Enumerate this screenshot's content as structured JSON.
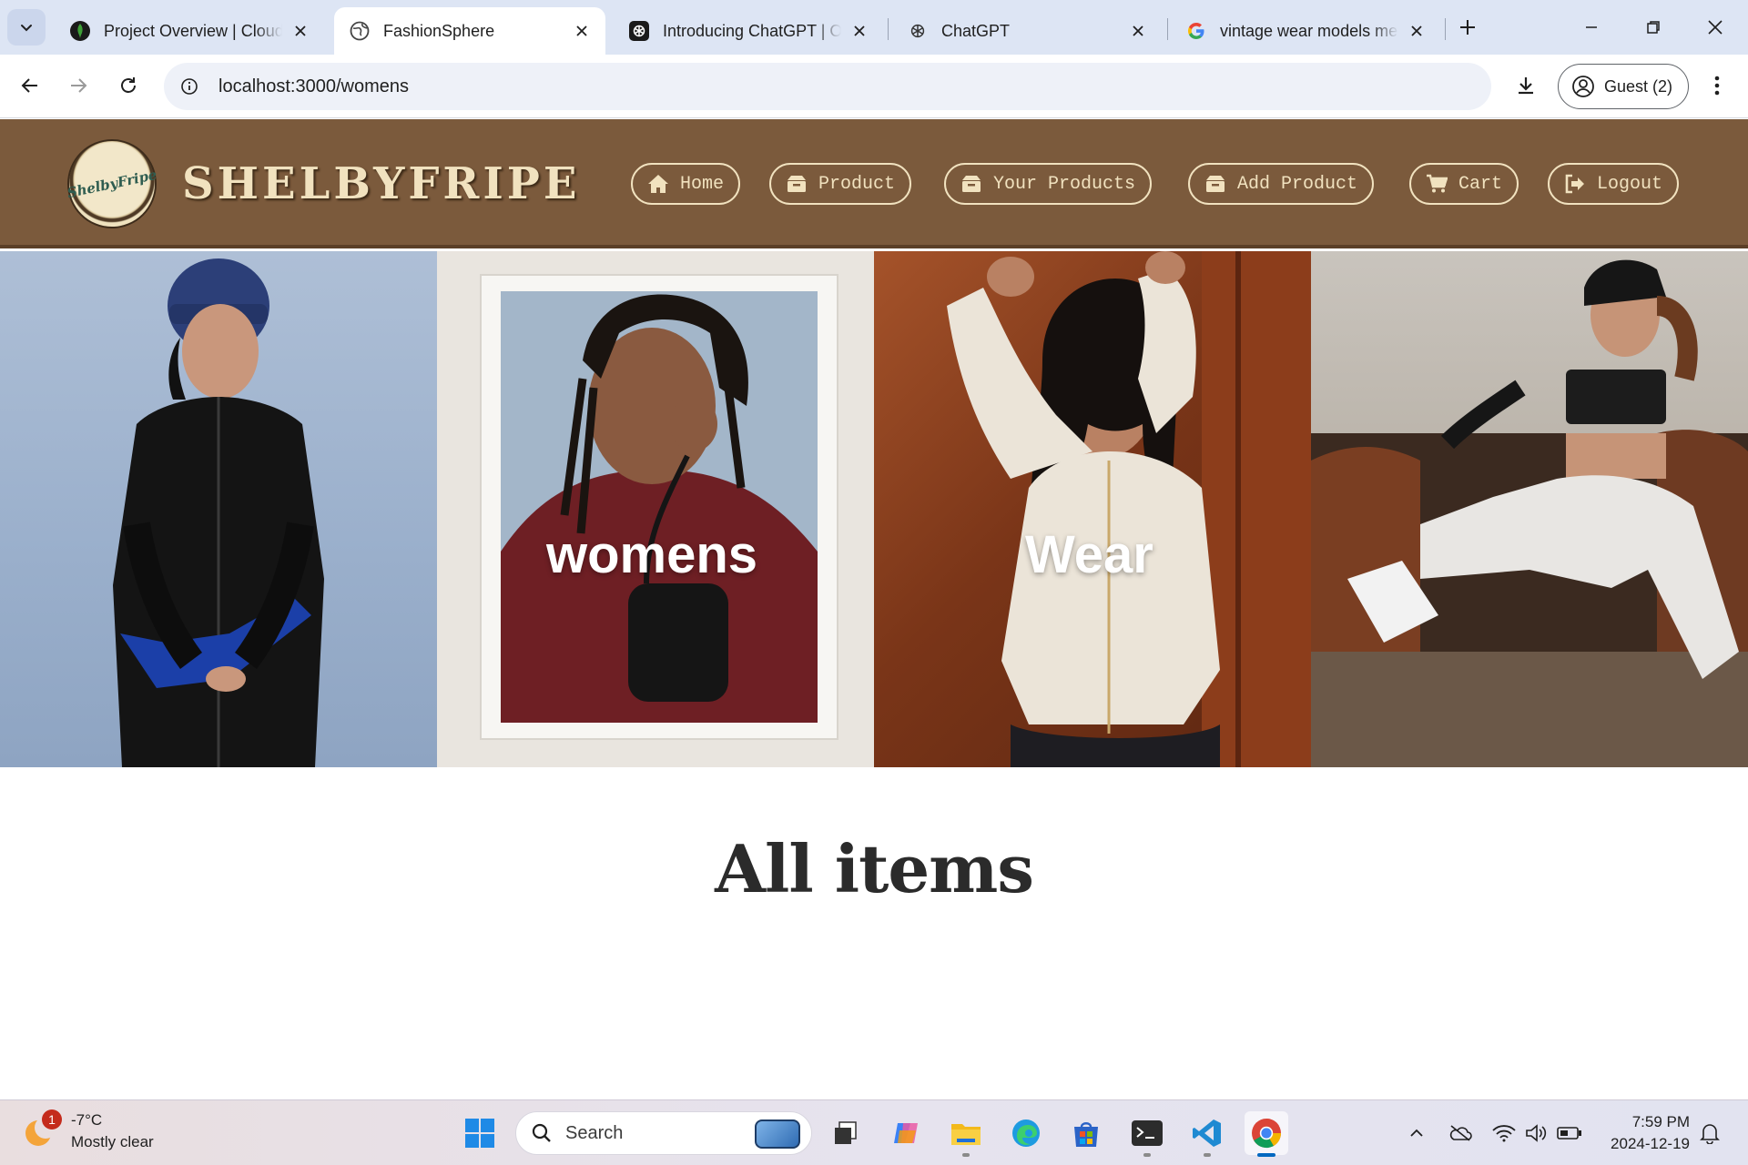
{
  "browser": {
    "tabs": [
      {
        "title": "Project Overview | Cloud",
        "icon": "mongodb-leaf-icon",
        "active": false
      },
      {
        "title": "FashionSphere",
        "icon": "globe-icon",
        "active": true
      },
      {
        "title": "Introducing ChatGPT | Op",
        "icon": "openai-icon",
        "active": false
      },
      {
        "title": "ChatGPT",
        "icon": "openai-icon",
        "active": false
      },
      {
        "title": "vintage wear models men",
        "icon": "google-icon",
        "active": false
      }
    ],
    "url": "localhost:3000/womens",
    "profile_label": "Guest (2)"
  },
  "site": {
    "brand": "SHELBYFRIPE",
    "logo_text": "ShelbyFripe",
    "nav": [
      {
        "label": "Home",
        "icon": "home-icon"
      },
      {
        "label": "Product",
        "icon": "box-icon"
      },
      {
        "label": "Your Products",
        "icon": "box-icon"
      },
      {
        "label": "Add Product",
        "icon": "box-icon"
      },
      {
        "label": "Cart",
        "icon": "cart-icon"
      },
      {
        "label": "Logout",
        "icon": "logout-icon"
      }
    ],
    "hero_words": [
      "womens",
      "Wear"
    ],
    "section_title": "All items"
  },
  "colors": {
    "header_bg": "#7b5a3c",
    "header_text": "#f1e2bf",
    "title_text": "#2b2b2b"
  },
  "taskbar": {
    "weather_temp": "-7°C",
    "weather_desc": "Mostly clear",
    "weather_badge": "1",
    "search_label": "Search",
    "time": "7:59 PM",
    "date": "2024-12-19"
  }
}
